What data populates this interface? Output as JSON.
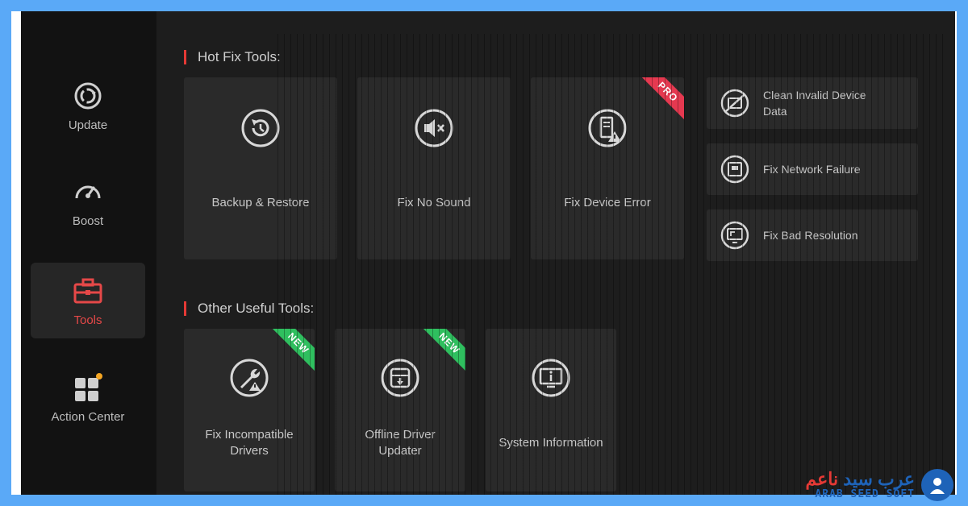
{
  "sidebar": {
    "items": [
      {
        "label": "Update",
        "icon": "update-icon"
      },
      {
        "label": "Boost",
        "icon": "speedometer-icon"
      },
      {
        "label": "Tools",
        "icon": "toolbox-icon",
        "active": true
      },
      {
        "label": "Action Center",
        "icon": "apps-grid-icon"
      }
    ]
  },
  "hotfix": {
    "title": "Hot Fix Tools:",
    "cards": [
      {
        "label": "Backup & Restore",
        "icon": "backup-restore-icon"
      },
      {
        "label": "Fix No Sound",
        "icon": "mute-speaker-icon"
      },
      {
        "label": "Fix Device Error",
        "icon": "device-warning-icon",
        "badge": "PRO"
      }
    ],
    "side_items": [
      {
        "label_line1": "Clean Invalid Device",
        "label_line2": "Data",
        "icon": "device-clean-icon"
      },
      {
        "label_line1": "Fix Network Failure",
        "icon": "network-icon"
      },
      {
        "label_line1": "Fix Bad Resolution",
        "icon": "monitor-resolution-icon"
      }
    ]
  },
  "other": {
    "title": "Other Useful Tools:",
    "cards": [
      {
        "label_line1": "Fix Incompatible",
        "label_line2": "Drivers",
        "icon": "wrench-warning-icon",
        "badge": "NEW"
      },
      {
        "label_line1": "Offline Driver",
        "label_line2": "Updater",
        "icon": "offline-download-icon",
        "badge": "NEW"
      },
      {
        "label_line1": "System Information",
        "icon": "system-info-icon"
      }
    ]
  },
  "watermark": {
    "arabic_part1": "عرب",
    "arabic_part2": "سيد",
    "arabic_part3": "ناعم",
    "english": "ARAB SEED SOFT"
  },
  "colors": {
    "accent_red": "#e53935",
    "badge_pro": "#e53950",
    "badge_new": "#2fbf5f",
    "frame_blue": "#5aa9f7"
  }
}
